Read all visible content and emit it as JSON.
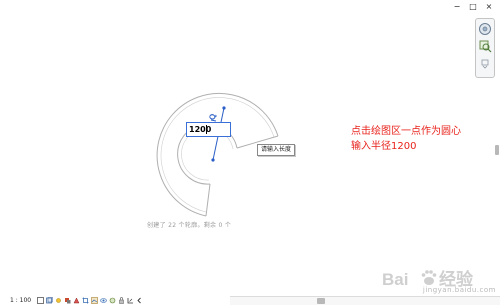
{
  "window": {
    "controls": [
      "−",
      "□",
      "×"
    ]
  },
  "navigation_bar": {
    "icons": [
      "steering-wheel-icon",
      "zoom-region-icon"
    ]
  },
  "drawing": {
    "radius_value": "1200",
    "tooltip": "请输入长度",
    "status_line": "创建了 22 个轮廓。剩余 0 个"
  },
  "annotation": {
    "line1": "点击绘图区一点作为圆心",
    "line2": "输入半径1200"
  },
  "view_control_bar": {
    "scale": "1 : 100",
    "icons": [
      "detail-level-icon",
      "visual-style-icon",
      "sun-path-icon",
      "shadows-icon",
      "render-icon",
      "crop-region-icon",
      "show-crop-icon",
      "temporary-hide-icon",
      "reveal-hidden-icon",
      "lock-3d-icon",
      "analytical-model-icon"
    ]
  },
  "watermark": {
    "brand": "Baidu",
    "sub": "jingyan.baidu.com"
  },
  "colors": {
    "annotation": "#e8231c",
    "sketch_line": "#b0b0b0",
    "dimension": "#2b5fc7",
    "input_border": "#3b6fd8"
  }
}
